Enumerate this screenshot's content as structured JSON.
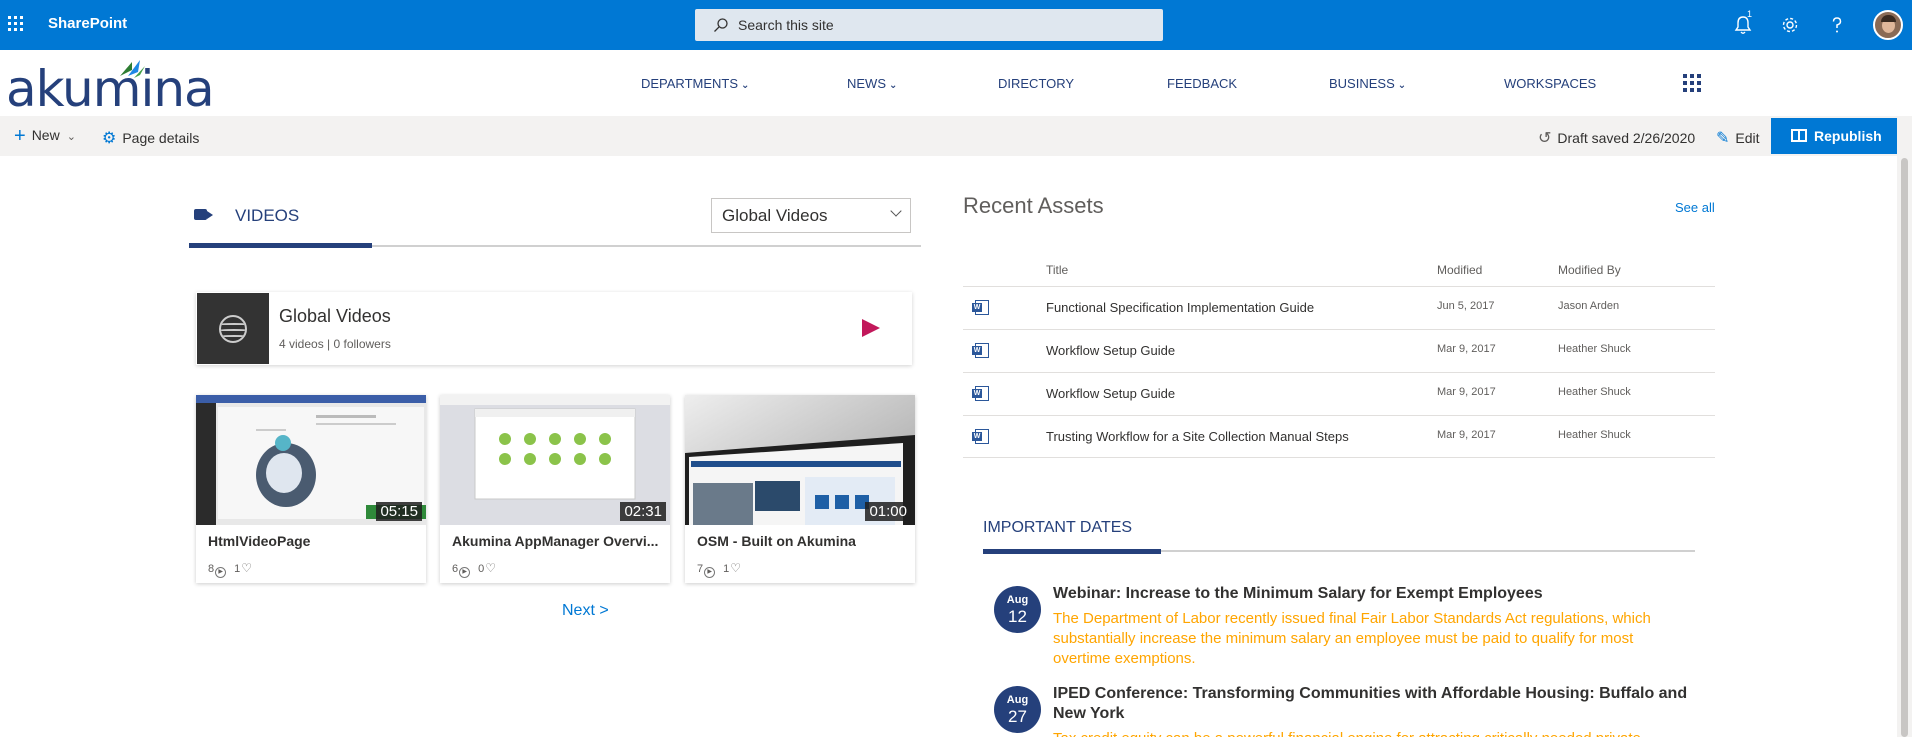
{
  "suite_bar": {
    "app_name": "SharePoint",
    "search_placeholder": "Search this site",
    "notification_count": "1",
    "icons": [
      "app-launcher-icon",
      "search-icon",
      "notification-bell-icon",
      "settings-gear-icon",
      "help-icon",
      "avatar"
    ]
  },
  "site_header": {
    "logo_text": "akumina",
    "nav": [
      {
        "label": "DEPARTMENTS",
        "has_dropdown": true
      },
      {
        "label": "NEWS",
        "has_dropdown": true
      },
      {
        "label": "DIRECTORY",
        "has_dropdown": false
      },
      {
        "label": "FEEDBACK",
        "has_dropdown": false
      },
      {
        "label": "BUSINESS",
        "has_dropdown": true
      },
      {
        "label": "WORKSPACES",
        "has_dropdown": false
      }
    ]
  },
  "command_bar": {
    "new_label": "New",
    "page_details_label": "Page details",
    "draft_status": "Draft saved 2/26/2020",
    "edit_label": "Edit",
    "republish_label": "Republish"
  },
  "videos": {
    "tab_label": "VIDEOS",
    "dropdown_value": "Global Videos",
    "channel": {
      "title": "Global Videos",
      "meta": "4 videos | 0 followers"
    },
    "items": [
      {
        "title": "HtmlVideoPage",
        "duration": "05:15",
        "views": "8",
        "likes": "1"
      },
      {
        "title": "Akumina AppManager Overvi...",
        "duration": "02:31",
        "views": "6",
        "likes": "0"
      },
      {
        "title": "OSM - Built on Akumina",
        "duration": "01:00",
        "views": "7",
        "likes": "1"
      }
    ],
    "next_label": "Next >"
  },
  "recent_assets": {
    "title": "Recent Assets",
    "see_all": "See all",
    "columns": [
      "Title",
      "Modified",
      "Modified By"
    ],
    "rows": [
      {
        "title": "Functional Specification Implementation Guide",
        "modified": "Jun 5, 2017",
        "modified_by": "Jason Arden"
      },
      {
        "title": "Workflow Setup Guide",
        "modified": "Mar 9, 2017",
        "modified_by": "Heather Shuck"
      },
      {
        "title": "Workflow Setup Guide",
        "modified": "Mar 9, 2017",
        "modified_by": "Heather Shuck"
      },
      {
        "title": "Trusting Workflow for a Site Collection Manual Steps",
        "modified": "Mar 9, 2017",
        "modified_by": "Heather Shuck"
      }
    ]
  },
  "important_dates": {
    "title": "IMPORTANT DATES",
    "events": [
      {
        "month": "Aug",
        "day": "12",
        "title": "Webinar: Increase to the Minimum Salary for Exempt Employees",
        "description": "The Department of Labor recently issued final Fair Labor Standards Act regulations, which substantially increase the minimum salary an employee must be paid to qualify for most overtime exemptions."
      },
      {
        "month": "Aug",
        "day": "27",
        "title": "IPED Conference: Transforming Communities with Affordable Housing: Buffalo and New York",
        "description": "Tax credit equity can be a powerful financial engine for attracting critically needed private"
      }
    ]
  },
  "colors": {
    "suite_bar": "#0078d4",
    "brand_navy": "#25407b",
    "event_description": "#ffa500",
    "link": "#0078d4"
  }
}
